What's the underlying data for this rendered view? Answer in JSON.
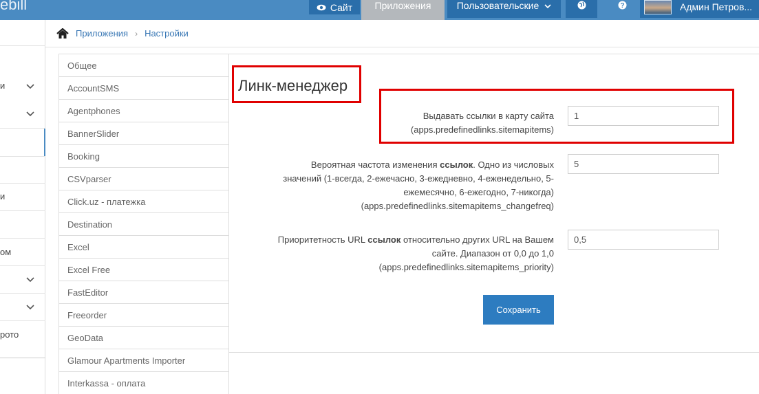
{
  "header": {
    "brand": "ebill",
    "site_label": "Сайт",
    "apps_label": "Приложения",
    "users_label": "Пользовательские",
    "user_name": "Админ Петров..."
  },
  "sidebar": {
    "items": [
      "и",
      "и",
      "ом",
      "рото"
    ]
  },
  "breadcrumb": {
    "items": [
      "Приложения",
      "Настройки"
    ]
  },
  "nav": {
    "items": [
      "Общее",
      "AccountSMS",
      "Agentphones",
      "BannerSlider",
      "Booking",
      "CSVparser",
      "Click.uz - платежка",
      "Destination",
      "Excel",
      "Excel Free",
      "FastEditor",
      "Freeorder",
      "GeoData",
      "Glamour Apartments Importer",
      "Interkassa - оплата"
    ]
  },
  "main": {
    "title": "Линк-менеджер",
    "fields": [
      {
        "label_line1": "Выдавать ссылки в карту сайта",
        "label_line2": "(apps.predefinedlinks.sitemapitems)",
        "value": "1"
      },
      {
        "label_line1a": "Вероятная частота изменения ",
        "label_line1b": "ссылок",
        "label_line1c": ". Одно из числовых",
        "label_line2": "значений (1-всегда, 2-ежечасно, 3-ежедневно, 4-еженедельно, 5-",
        "label_line3": "ежемесячно, 6-ежегодно, 7-никогда)",
        "label_line4": "(apps.predefinedlinks.sitemapitems_changefreq)",
        "value": "5"
      },
      {
        "label_line1a": "Приоритетность URL ",
        "label_line1b": "ссылок",
        "label_line1c": " относительно других URL на Вашем",
        "label_line2": "сайте. Диапазон от 0,0 до 1,0",
        "label_line3": "(apps.predefinedlinks.sitemapitems_priority)",
        "value": "0,5"
      }
    ],
    "save_label": "Сохранить"
  },
  "colors": {
    "topbar": "#4a8bc2",
    "button_dark": "#2a6eaa",
    "save_button": "#2d7cc0",
    "highlight": "#e00000"
  }
}
